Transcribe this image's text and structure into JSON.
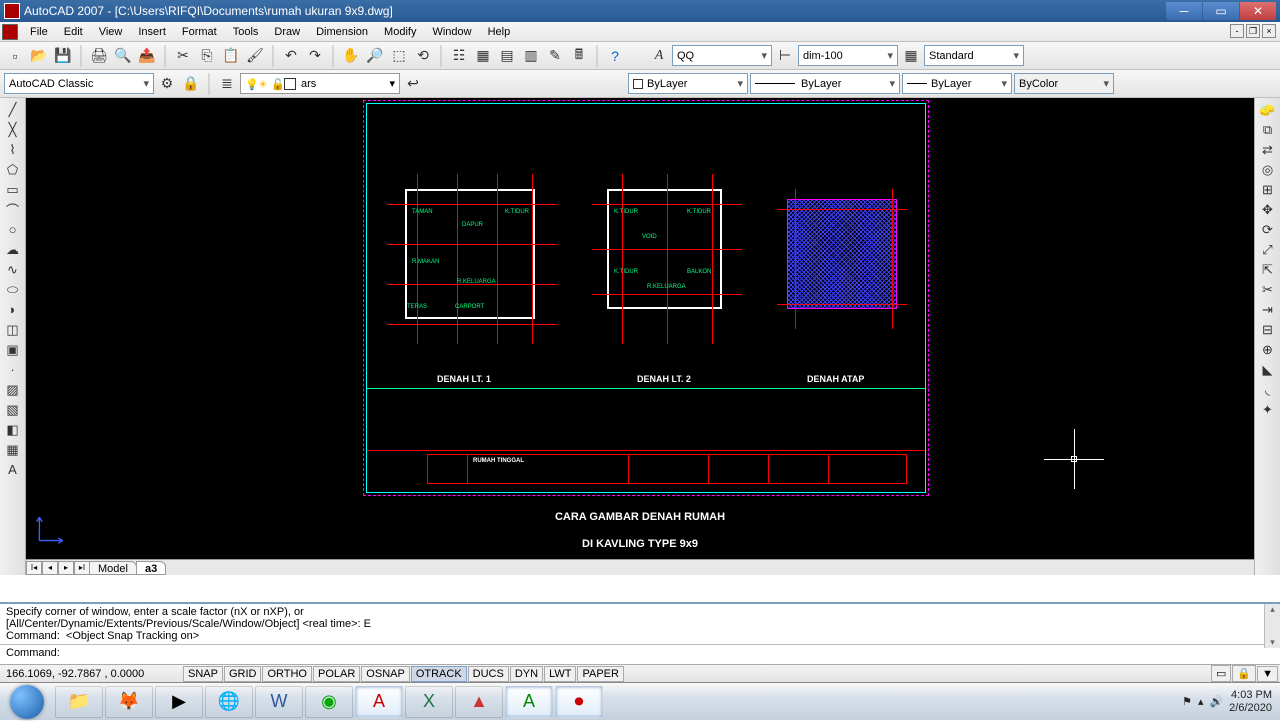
{
  "window": {
    "title": "AutoCAD 2007 - [C:\\Users\\RIFQI\\Documents\\rumah ukuran 9x9.dwg]"
  },
  "menu": {
    "items": [
      "File",
      "Edit",
      "View",
      "Insert",
      "Format",
      "Tools",
      "Draw",
      "Dimension",
      "Modify",
      "Window",
      "Help"
    ]
  },
  "toolbar1": {
    "workspace": "AutoCAD Classic",
    "textstyle_icon": "A",
    "textstyle": "QQ",
    "dimstyle": "dim-100",
    "tablestyle": "Standard"
  },
  "toolbar2": {
    "layer": "ars",
    "color": "ByLayer",
    "linetype": "ByLayer",
    "lineweight": "ByLayer",
    "plotstyle": "ByColor"
  },
  "drawing": {
    "labels": {
      "plan1": "DENAH LT. 1",
      "plan2": "DENAH LT. 2",
      "roof": "DENAH ATAP"
    },
    "titleblock": {
      "project": "RUMAH TINGGAL"
    },
    "overlay1": "CARA GAMBAR DENAH RUMAH",
    "overlay2": "DI KAVLING TYPE 9x9"
  },
  "tabs": {
    "model": "Model",
    "layout": "a3"
  },
  "command": {
    "hist": "Specify corner of window, enter a scale factor (nX or nXP), or\n[All/Center/Dynamic/Extents/Previous/Scale/Window/Object] <real time>: E\nCommand:  <Object Snap Tracking on>",
    "prompt": "Command: "
  },
  "status": {
    "coords": "166.1069, -92.7867 , 0.0000",
    "toggles": [
      "SNAP",
      "GRID",
      "ORTHO",
      "POLAR",
      "OSNAP",
      "OTRACK",
      "DUCS",
      "DYN",
      "LWT",
      "PAPER"
    ]
  },
  "tray": {
    "time": "4:03 PM",
    "date": "2/6/2020"
  }
}
